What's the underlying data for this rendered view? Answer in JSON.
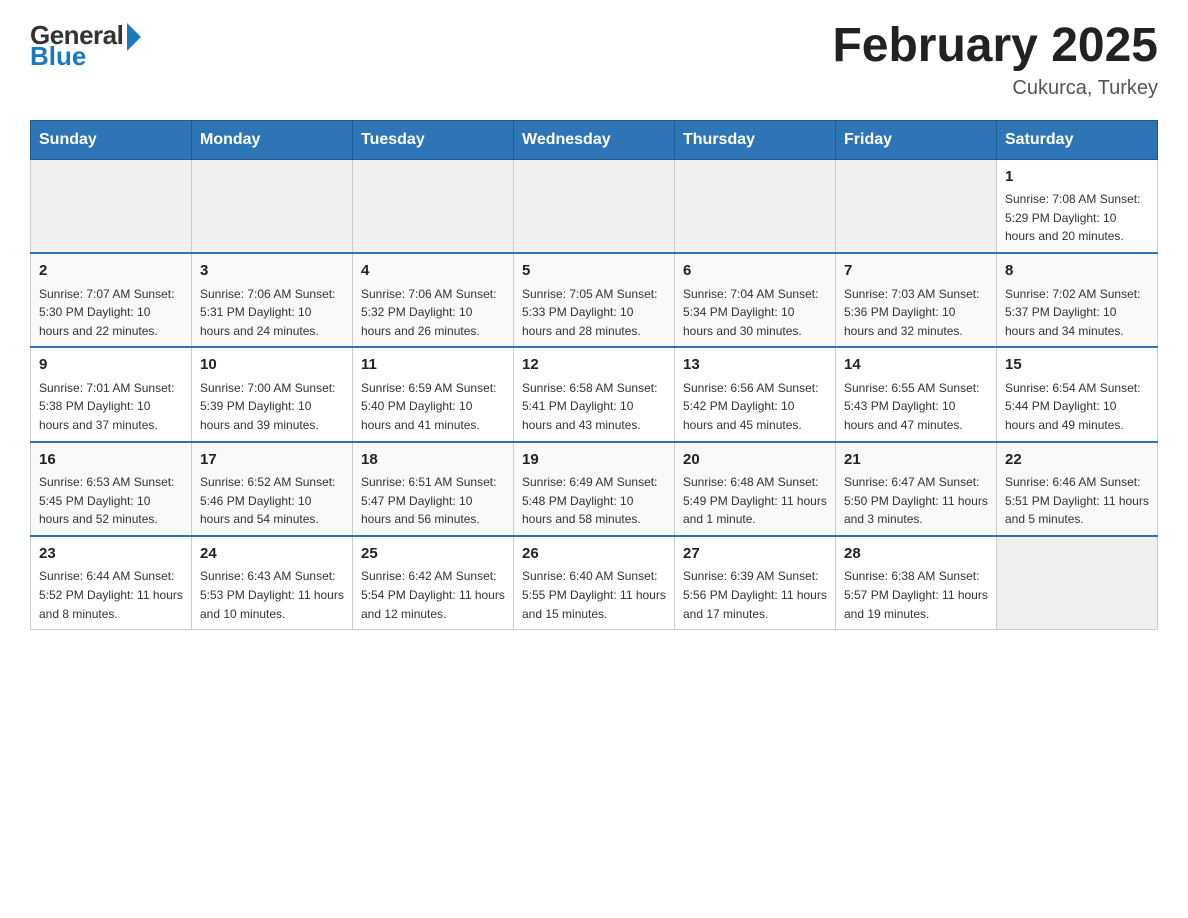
{
  "header": {
    "logo_general": "General",
    "logo_blue": "Blue",
    "title": "February 2025",
    "subtitle": "Cukurca, Turkey"
  },
  "days_of_week": [
    "Sunday",
    "Monday",
    "Tuesday",
    "Wednesday",
    "Thursday",
    "Friday",
    "Saturday"
  ],
  "weeks": [
    [
      {
        "day": "",
        "info": ""
      },
      {
        "day": "",
        "info": ""
      },
      {
        "day": "",
        "info": ""
      },
      {
        "day": "",
        "info": ""
      },
      {
        "day": "",
        "info": ""
      },
      {
        "day": "",
        "info": ""
      },
      {
        "day": "1",
        "info": "Sunrise: 7:08 AM\nSunset: 5:29 PM\nDaylight: 10 hours\nand 20 minutes."
      }
    ],
    [
      {
        "day": "2",
        "info": "Sunrise: 7:07 AM\nSunset: 5:30 PM\nDaylight: 10 hours\nand 22 minutes."
      },
      {
        "day": "3",
        "info": "Sunrise: 7:06 AM\nSunset: 5:31 PM\nDaylight: 10 hours\nand 24 minutes."
      },
      {
        "day": "4",
        "info": "Sunrise: 7:06 AM\nSunset: 5:32 PM\nDaylight: 10 hours\nand 26 minutes."
      },
      {
        "day": "5",
        "info": "Sunrise: 7:05 AM\nSunset: 5:33 PM\nDaylight: 10 hours\nand 28 minutes."
      },
      {
        "day": "6",
        "info": "Sunrise: 7:04 AM\nSunset: 5:34 PM\nDaylight: 10 hours\nand 30 minutes."
      },
      {
        "day": "7",
        "info": "Sunrise: 7:03 AM\nSunset: 5:36 PM\nDaylight: 10 hours\nand 32 minutes."
      },
      {
        "day": "8",
        "info": "Sunrise: 7:02 AM\nSunset: 5:37 PM\nDaylight: 10 hours\nand 34 minutes."
      }
    ],
    [
      {
        "day": "9",
        "info": "Sunrise: 7:01 AM\nSunset: 5:38 PM\nDaylight: 10 hours\nand 37 minutes."
      },
      {
        "day": "10",
        "info": "Sunrise: 7:00 AM\nSunset: 5:39 PM\nDaylight: 10 hours\nand 39 minutes."
      },
      {
        "day": "11",
        "info": "Sunrise: 6:59 AM\nSunset: 5:40 PM\nDaylight: 10 hours\nand 41 minutes."
      },
      {
        "day": "12",
        "info": "Sunrise: 6:58 AM\nSunset: 5:41 PM\nDaylight: 10 hours\nand 43 minutes."
      },
      {
        "day": "13",
        "info": "Sunrise: 6:56 AM\nSunset: 5:42 PM\nDaylight: 10 hours\nand 45 minutes."
      },
      {
        "day": "14",
        "info": "Sunrise: 6:55 AM\nSunset: 5:43 PM\nDaylight: 10 hours\nand 47 minutes."
      },
      {
        "day": "15",
        "info": "Sunrise: 6:54 AM\nSunset: 5:44 PM\nDaylight: 10 hours\nand 49 minutes."
      }
    ],
    [
      {
        "day": "16",
        "info": "Sunrise: 6:53 AM\nSunset: 5:45 PM\nDaylight: 10 hours\nand 52 minutes."
      },
      {
        "day": "17",
        "info": "Sunrise: 6:52 AM\nSunset: 5:46 PM\nDaylight: 10 hours\nand 54 minutes."
      },
      {
        "day": "18",
        "info": "Sunrise: 6:51 AM\nSunset: 5:47 PM\nDaylight: 10 hours\nand 56 minutes."
      },
      {
        "day": "19",
        "info": "Sunrise: 6:49 AM\nSunset: 5:48 PM\nDaylight: 10 hours\nand 58 minutes."
      },
      {
        "day": "20",
        "info": "Sunrise: 6:48 AM\nSunset: 5:49 PM\nDaylight: 11 hours\nand 1 minute."
      },
      {
        "day": "21",
        "info": "Sunrise: 6:47 AM\nSunset: 5:50 PM\nDaylight: 11 hours\nand 3 minutes."
      },
      {
        "day": "22",
        "info": "Sunrise: 6:46 AM\nSunset: 5:51 PM\nDaylight: 11 hours\nand 5 minutes."
      }
    ],
    [
      {
        "day": "23",
        "info": "Sunrise: 6:44 AM\nSunset: 5:52 PM\nDaylight: 11 hours\nand 8 minutes."
      },
      {
        "day": "24",
        "info": "Sunrise: 6:43 AM\nSunset: 5:53 PM\nDaylight: 11 hours\nand 10 minutes."
      },
      {
        "day": "25",
        "info": "Sunrise: 6:42 AM\nSunset: 5:54 PM\nDaylight: 11 hours\nand 12 minutes."
      },
      {
        "day": "26",
        "info": "Sunrise: 6:40 AM\nSunset: 5:55 PM\nDaylight: 11 hours\nand 15 minutes."
      },
      {
        "day": "27",
        "info": "Sunrise: 6:39 AM\nSunset: 5:56 PM\nDaylight: 11 hours\nand 17 minutes."
      },
      {
        "day": "28",
        "info": "Sunrise: 6:38 AM\nSunset: 5:57 PM\nDaylight: 11 hours\nand 19 minutes."
      },
      {
        "day": "",
        "info": ""
      }
    ]
  ]
}
